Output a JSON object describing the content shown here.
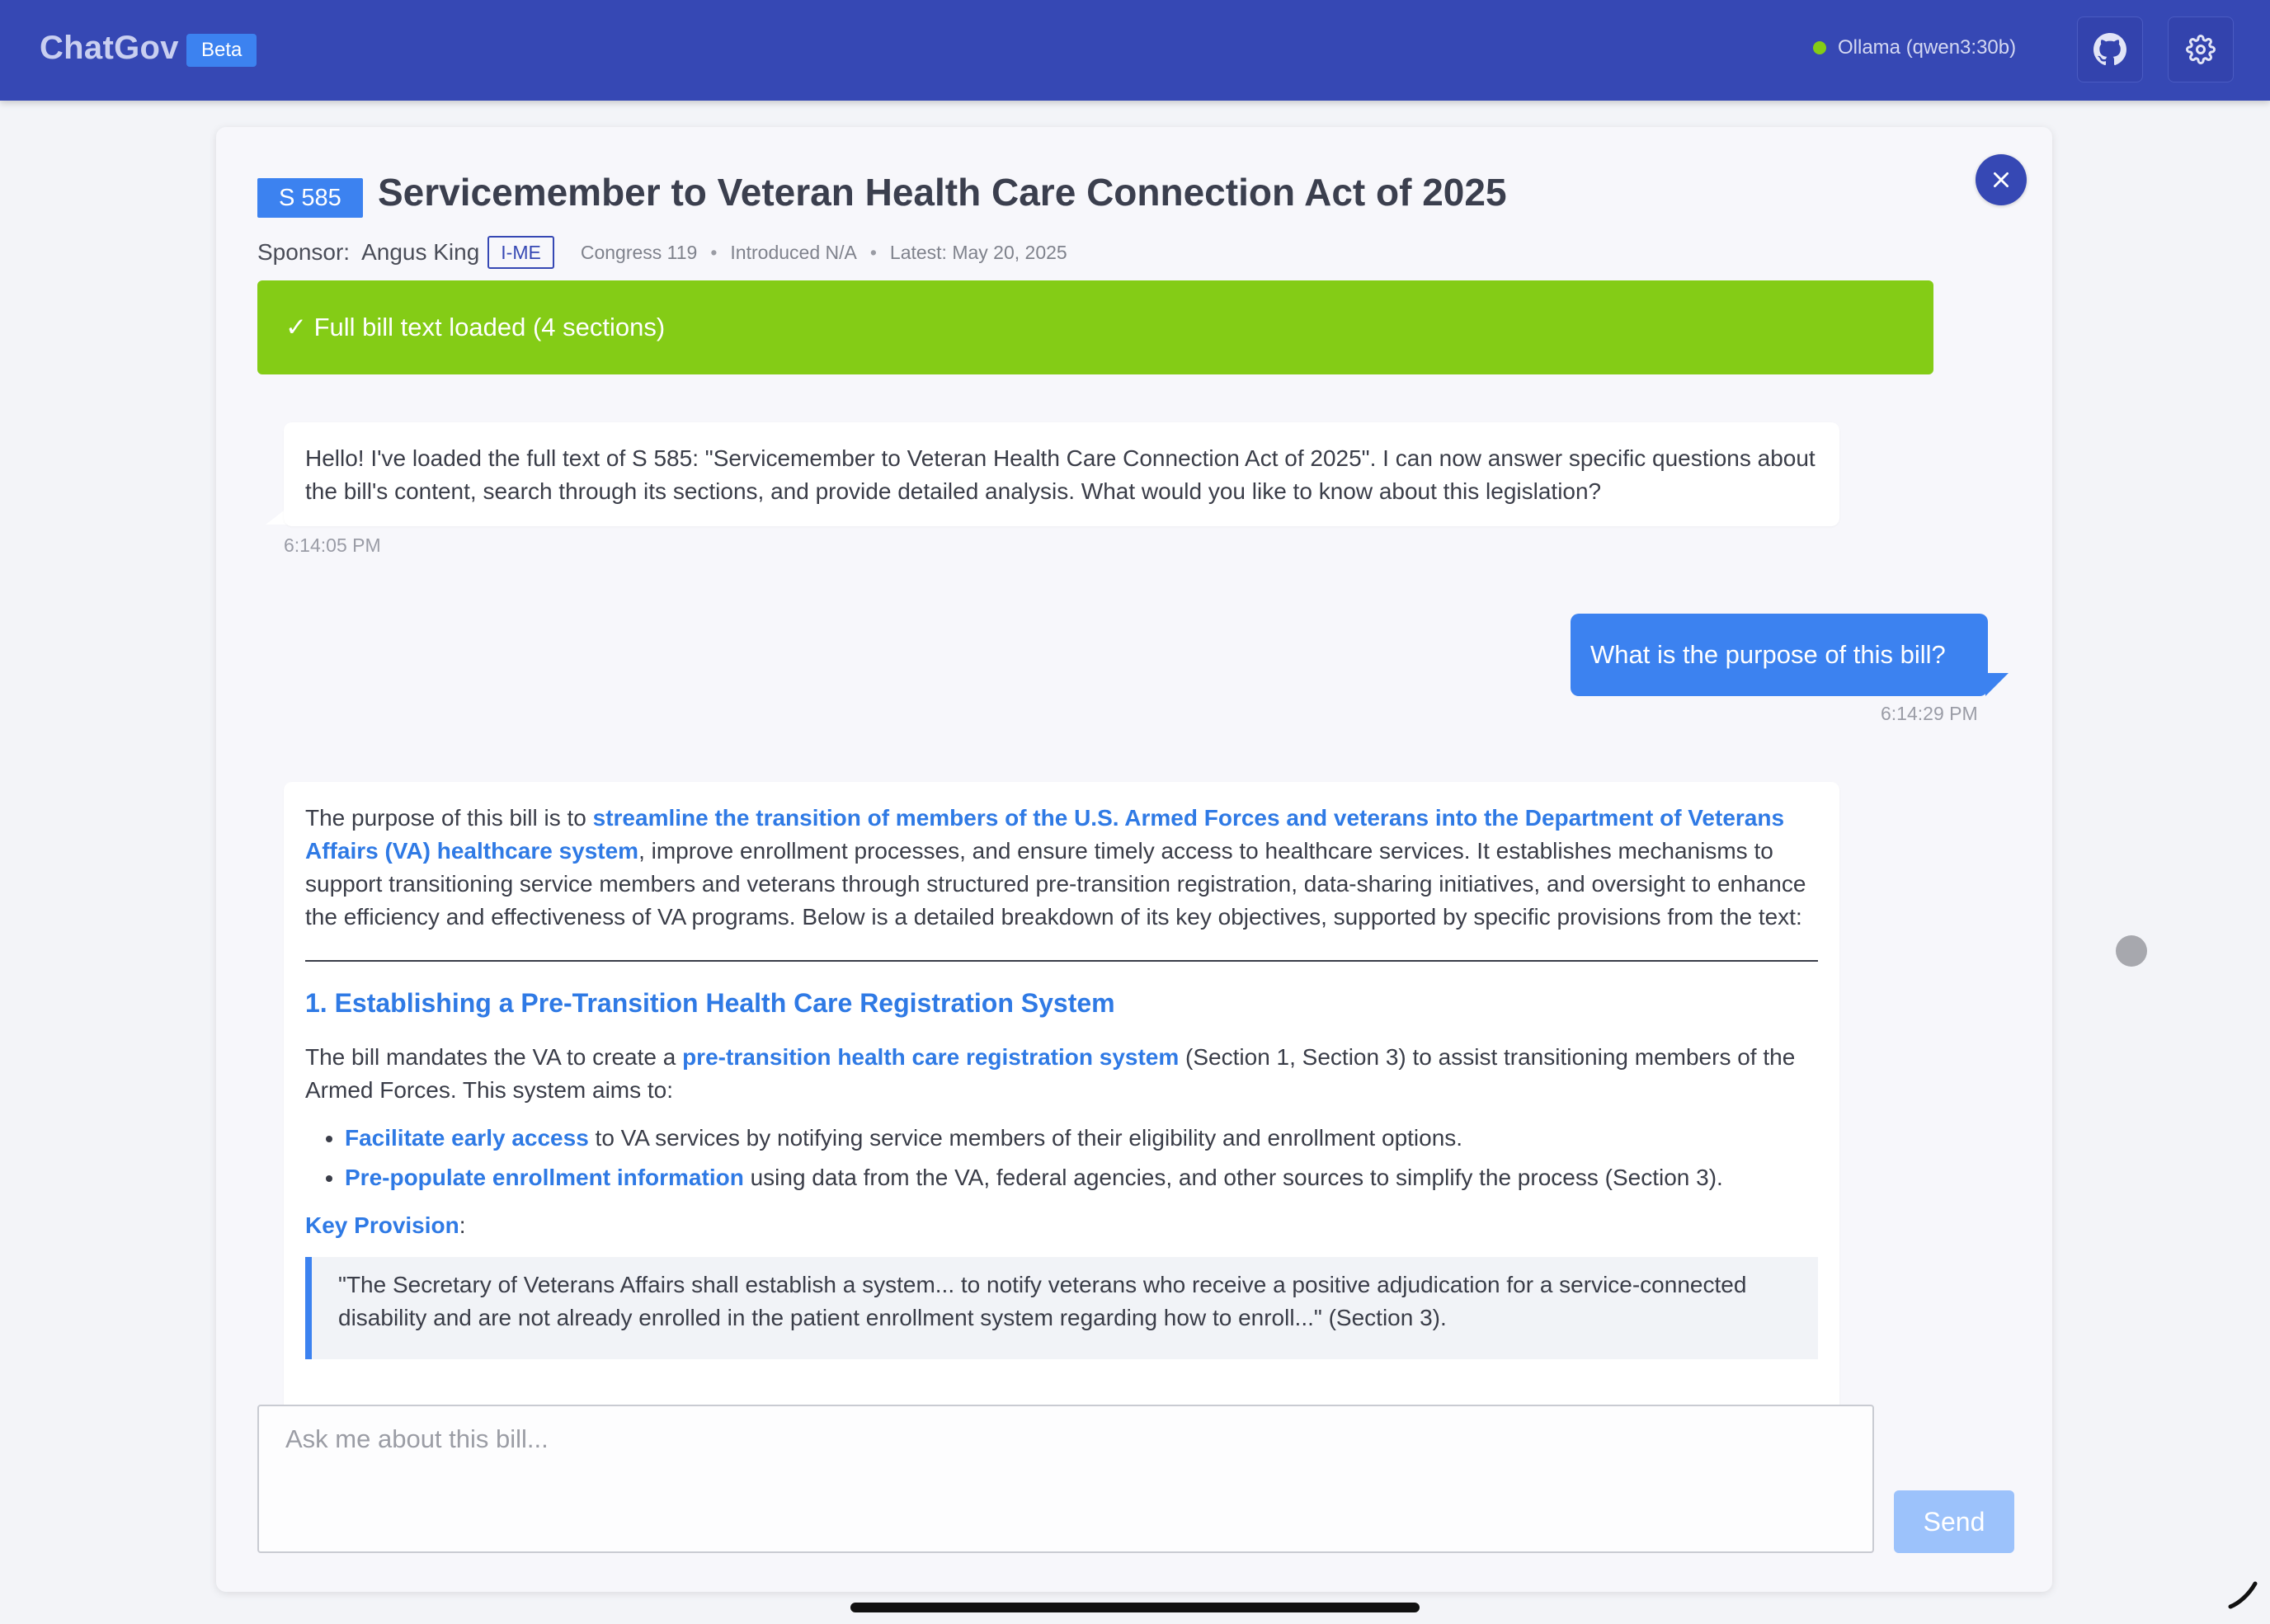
{
  "header": {
    "brand": "ChatGov",
    "badge": "Beta",
    "model_status": "Ollama (qwen3:30b)",
    "status_color": "#84cc16",
    "accent": "#3648b4"
  },
  "bill": {
    "id": "S 585",
    "title": "Servicemember to Veteran Health Care Connection Act of 2025",
    "sponsor_label": "Sponsor:",
    "sponsor_name": "Angus King",
    "party": "I-ME",
    "congress": "Congress 119",
    "introduced": "Introduced N/A",
    "latest": "Latest: May 20, 2025",
    "separator": "•"
  },
  "banner": {
    "text": "✓ Full bill text loaded (4 sections)",
    "color": "#84cc16"
  },
  "messages": [
    {
      "role": "assistant",
      "text": "Hello! I've loaded the full text of S 585: \"Servicemember to Veteran Health Care Connection Act of 2025\". I can now answer specific questions about the bill's content, search through its sections, and provide detailed analysis. What would you like to know about this legislation?",
      "time": "6:14:05 PM"
    },
    {
      "role": "user",
      "text": "What is the purpose of this bill?",
      "time": "6:14:29 PM"
    },
    {
      "role": "assistant",
      "intro_prefix": "The purpose of this bill is to ",
      "intro_highlight": "streamline the transition of members of the U.S. Armed Forces and veterans into the Department of Veterans Affairs (VA) healthcare system",
      "intro_suffix": ", improve enrollment processes, and ensure timely access to healthcare services. It establishes mechanisms to support transitioning service members and veterans through structured pre-transition registration, data-sharing initiatives, and oversight to enhance the efficiency and effectiveness of VA programs. Below is a detailed breakdown of its key objectives, supported by specific provisions from the text:",
      "section_heading": "1. Establishing a Pre-Transition Health Care Registration System",
      "para_prefix": "The bill mandates the VA to create a ",
      "para_highlight": "pre-transition health care registration system",
      "para_suffix": " (Section 1, Section 3) to assist transitioning members of the Armed Forces. This system aims to:",
      "bullets": [
        {
          "highlight": "Facilitate early access",
          "rest": " to VA services by notifying service members of their eligibility and enrollment options."
        },
        {
          "highlight": "Pre-populate enrollment information",
          "rest": " using data from the VA, federal agencies, and other sources to simplify the process (Section 3)."
        }
      ],
      "key_label": "Key Provision",
      "key_colon": ":",
      "quote": "\"The Secretary of Veterans Affairs shall establish a system... to notify veterans who receive a positive adjudication for a service-connected disability and are not already enrolled in the patient enrollment system regarding how to enroll...\" (Section 3)."
    }
  ],
  "composer": {
    "placeholder": "Ask me about this bill...",
    "send_label": "Send"
  }
}
